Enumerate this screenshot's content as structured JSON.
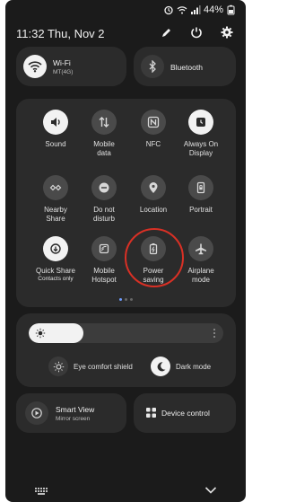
{
  "status_bar": {
    "battery": "44%"
  },
  "header": {
    "datetime": "11:32  Thu, Nov 2"
  },
  "wifi": {
    "title": "Wi-Fi",
    "subtitle": "MT(4G)"
  },
  "bluetooth": {
    "title": "Bluetooth"
  },
  "tiles": [
    {
      "label": "Sound",
      "icon": "sound-icon",
      "on": true
    },
    {
      "label": "Mobile\ndata",
      "icon": "mobile-data-icon",
      "on": false
    },
    {
      "label": "NFC",
      "icon": "nfc-icon",
      "on": false
    },
    {
      "label": "Always On\nDisplay",
      "icon": "always-on-display-icon",
      "on": true
    },
    {
      "label": "Nearby\nShare",
      "icon": "nearby-share-icon",
      "on": false
    },
    {
      "label": "Do not\ndisturb",
      "icon": "do-not-disturb-icon",
      "on": false
    },
    {
      "label": "Location",
      "icon": "location-icon",
      "on": false
    },
    {
      "label": "Portrait",
      "icon": "portrait-lock-icon",
      "on": false
    },
    {
      "label": "Quick Share",
      "sub": "Contacts only",
      "icon": "quick-share-icon",
      "on": true
    },
    {
      "label": "Mobile\nHotspot",
      "icon": "hotspot-icon",
      "on": false
    },
    {
      "label": "Power\nsaving",
      "icon": "power-saving-icon",
      "on": false
    },
    {
      "label": "Airplane\nmode",
      "icon": "airplane-icon",
      "on": false
    }
  ],
  "brightness": {
    "level": 0.28
  },
  "eye_comfort": {
    "label": "Eye comfort shield"
  },
  "dark_mode": {
    "label": "Dark mode"
  },
  "smart_view": {
    "title": "Smart View",
    "subtitle": "Mirror screen"
  },
  "device_control": {
    "title": "Device control"
  },
  "colors": {
    "accent": "#6e9cff",
    "highlight": "#d93025"
  }
}
